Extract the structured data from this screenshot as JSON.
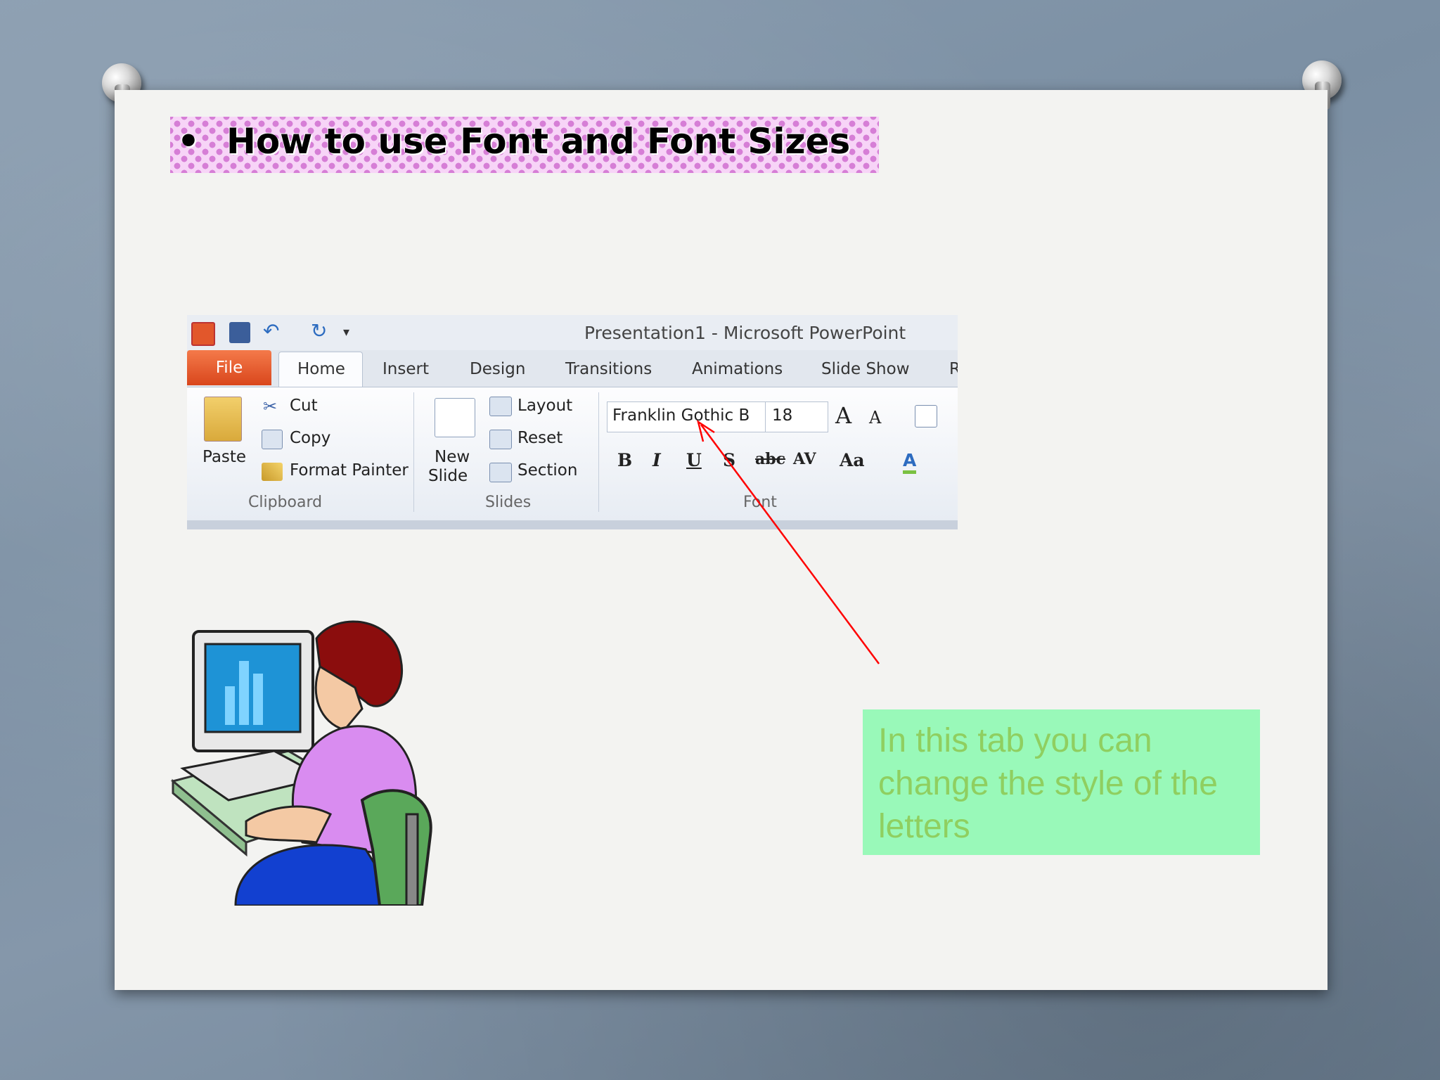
{
  "slide": {
    "bullet": "•",
    "title": "How to use Font and Font Sizes"
  },
  "ribbon": {
    "window_title": "Presentation1  -  Microsoft PowerPoint",
    "tabs": [
      "File",
      "Home",
      "Insert",
      "Design",
      "Transitions",
      "Animations",
      "Slide Show",
      "R"
    ],
    "clipboard": {
      "paste": "Paste",
      "cut": "Cut",
      "copy": "Copy",
      "format_painter": "Format Painter",
      "group_label": "Clipboard"
    },
    "slides": {
      "new_slide_line1": "New",
      "new_slide_line2": "Slide",
      "layout": "Layout",
      "reset": "Reset",
      "section": "Section",
      "group_label": "Slides"
    },
    "font": {
      "font_name": "Franklin Gothic B",
      "font_size": "18",
      "bold": "B",
      "italic": "I",
      "underline": "U",
      "shadow": "S",
      "strikethrough": "abc",
      "spacing": "AV",
      "change_case": "Aa",
      "font_color": "A",
      "grow": "A",
      "shrink": "A",
      "group_label": "Font"
    }
  },
  "callout": {
    "text": "In this tab you can change the style of the letters"
  },
  "colors": {
    "callout_bg": "#99f9b9",
    "callout_text": "#8fcf60",
    "arrow": "#ff0000",
    "file_tab": "#e2572b"
  }
}
